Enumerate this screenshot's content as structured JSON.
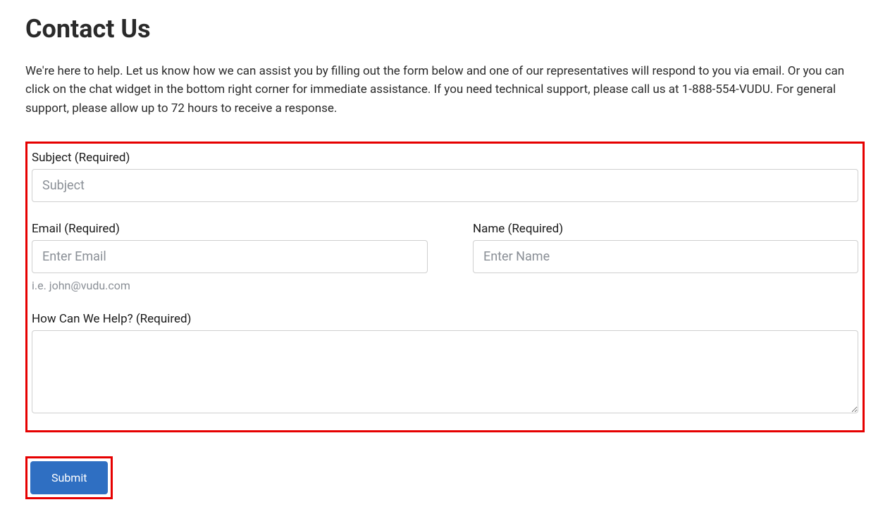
{
  "title": "Contact Us",
  "intro": "We're here to help. Let us know how we can assist you by filling out the form below and one of our representatives will respond to you via email. Or you can click on the chat widget in the bottom right corner for immediate assistance. If you need technical support, please call us at 1-888-554-VUDU. For general support, please allow up to 72 hours to receive a response.",
  "form": {
    "subject": {
      "label": "Subject (Required)",
      "placeholder": "Subject",
      "value": ""
    },
    "email": {
      "label": "Email (Required)",
      "placeholder": "Enter Email",
      "value": "",
      "hint": "i.e. john@vudu.com"
    },
    "name": {
      "label": "Name (Required)",
      "placeholder": "Enter Name",
      "value": ""
    },
    "help": {
      "label": "How Can We Help? (Required)",
      "value": ""
    },
    "submit_label": "Submit"
  }
}
